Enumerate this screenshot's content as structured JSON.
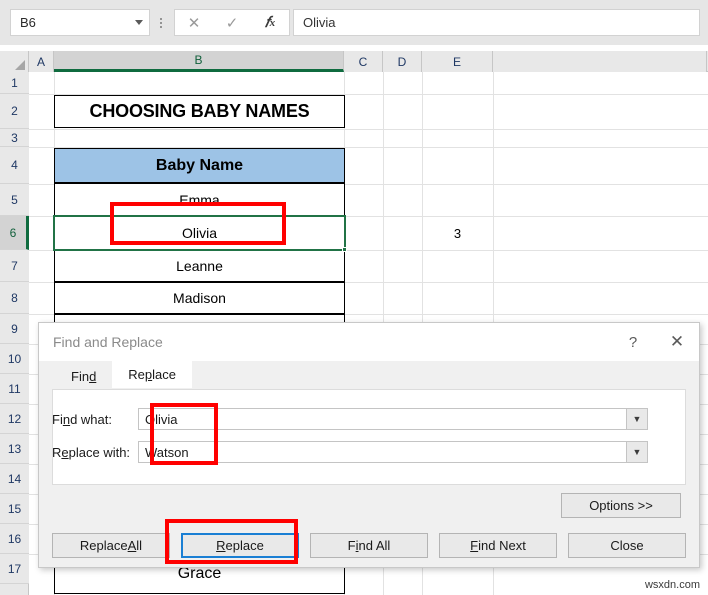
{
  "formula_bar": {
    "name_box_value": "B6",
    "cancel_icon": "close-icon",
    "enter_icon": "check-icon",
    "function_icon": "fx",
    "formula_value": "Olivia"
  },
  "grid": {
    "columns": [
      "A",
      "B",
      "C",
      "D",
      "E"
    ],
    "selected_column": "B",
    "rows": [
      "1",
      "2",
      "3",
      "4",
      "5",
      "6",
      "7",
      "8",
      "9",
      "10",
      "11",
      "12",
      "13",
      "14",
      "15",
      "16",
      "17"
    ],
    "selected_row": "6",
    "cells": {
      "title": "CHOOSING BABY NAMES",
      "header": "Baby Name",
      "names": [
        "Emma",
        "Olivia",
        "Leanne",
        "Madison"
      ],
      "bottom_name": "Grace",
      "e6_value": "3"
    }
  },
  "dialog": {
    "title": "Find and Replace",
    "help_label": "?",
    "close_label": "✕",
    "tabs": [
      {
        "label_pre": "Fin",
        "label_key": "d",
        "label_post": "",
        "active": false
      },
      {
        "label_pre": "Re",
        "label_key": "p",
        "label_post": "lace",
        "active": true
      }
    ],
    "find_label_pre": "Fi",
    "find_label_key": "n",
    "find_label_post": "d what:",
    "find_value": "Olivia",
    "replace_label_pre": "R",
    "replace_label_key": "e",
    "replace_label_post": "place with:",
    "replace_value": "Watson",
    "dropdown_icon": "chevron-down-icon",
    "options_label": "Options >>",
    "buttons": [
      {
        "pre": "Replace ",
        "key": "A",
        "post": "ll",
        "focused": false
      },
      {
        "pre": "",
        "key": "R",
        "post": "eplace",
        "focused": true
      },
      {
        "pre": "F",
        "key": "i",
        "post": "nd All",
        "focused": false
      },
      {
        "pre": "",
        "key": "F",
        "post": "ind Next",
        "focused": false
      },
      {
        "pre": "Close",
        "key": "",
        "post": "",
        "focused": false
      }
    ]
  },
  "annotations": {
    "color": "#ff0000"
  },
  "watermark": "wsxdn.com"
}
